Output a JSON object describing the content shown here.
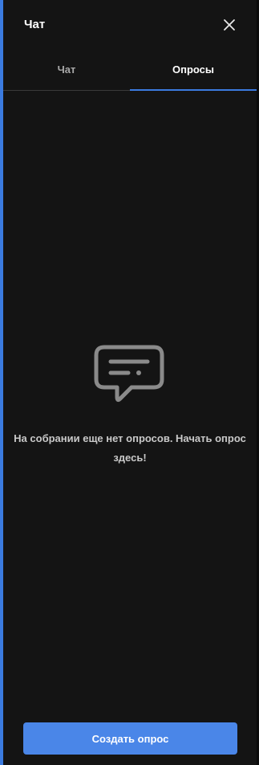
{
  "panel": {
    "title": "Чат",
    "close_icon": "close-icon"
  },
  "tabs": [
    {
      "label": "Чат",
      "active": false
    },
    {
      "label": "Опросы",
      "active": true
    }
  ],
  "empty_state": {
    "icon": "chat-bubble-icon",
    "message": "На собрании еще нет опросов. Начать опрос здесь!"
  },
  "actions": {
    "create_poll_label": "Создать опрос"
  },
  "colors": {
    "accent": "#3b7be0",
    "button": "#4a86e8",
    "background": "#141414"
  }
}
